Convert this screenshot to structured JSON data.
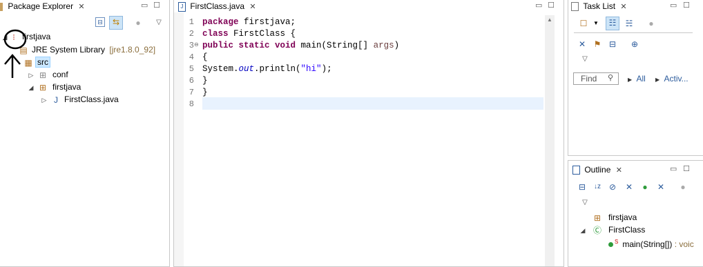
{
  "package_explorer": {
    "tab_title": "Package Explorer",
    "tree": [
      {
        "label": "firstjava",
        "extra": ""
      },
      {
        "label": "JRE System Library",
        "extra": "[jre1.8.0_92]"
      },
      {
        "label": "src",
        "extra": ""
      },
      {
        "label": "conf",
        "extra": ""
      },
      {
        "label": "firstjava",
        "extra": ""
      },
      {
        "label": "FirstClass.java",
        "extra": ""
      }
    ]
  },
  "editor": {
    "tab_title": "FirstClass.java",
    "line_numbers": [
      "1",
      "2",
      "3",
      "4",
      "5",
      "6",
      "7",
      "8"
    ],
    "code": {
      "l1_kw": "package",
      "l1_rest": " firstjava;",
      "l2_kw": "class",
      "l2_rest": " FirstClass {",
      "l3_kw": "public static void",
      "l3_rest": " main(String[] ",
      "l3_param": "args",
      "l3_end": ")",
      "l4": "{",
      "l5_pre": "System.",
      "l5_fld": "out",
      "l5_mid": ".println(",
      "l5_str": "\"hi\"",
      "l5_end": ");",
      "l6": "}",
      "l7": "}"
    }
  },
  "task_list": {
    "tab_title": "Task List",
    "find_placeholder": "Find",
    "all_label": "All",
    "activate_label": "Activ..."
  },
  "outline": {
    "tab_title": "Outline",
    "items": [
      {
        "label": "firstjava"
      },
      {
        "label": "FirstClass"
      },
      {
        "label": "main(String[])",
        "type": " : voic"
      }
    ]
  },
  "colors": {
    "keyword": "#7f0055",
    "string": "#2a00ff",
    "field": "#0000c0",
    "current_line": "#e8f2fe",
    "selection": "#cce8ff"
  }
}
